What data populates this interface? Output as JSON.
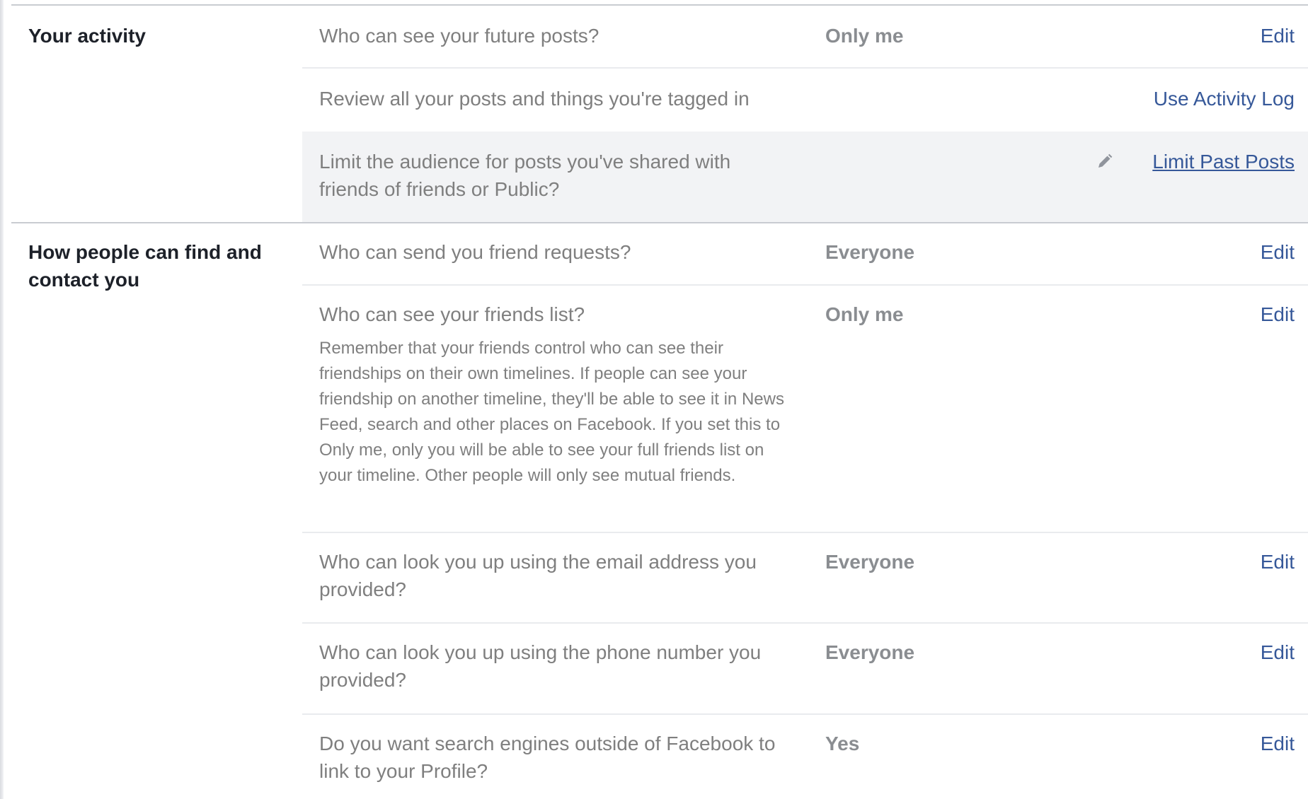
{
  "sections": [
    {
      "title": "Your activity",
      "rows": [
        {
          "question": "Who can see your future posts?",
          "value": "Only me",
          "action": "Edit"
        },
        {
          "question": "Review all your posts and things you're tagged in",
          "action": "Use Activity Log"
        },
        {
          "question": "Limit the audience for posts you've shared with friends of friends or Public?",
          "action": "Limit Past Posts",
          "icon": "pencil-icon"
        }
      ]
    },
    {
      "title": "How people can find and contact you",
      "rows": [
        {
          "question": "Who can send you friend requests?",
          "value": "Everyone",
          "action": "Edit"
        },
        {
          "question": "Who can see your friends list?",
          "value": "Only me",
          "action": "Edit",
          "help": "Remember that your friends control who can see their friendships on their own timelines. If people can see your friendship on another timeline, they'll be able to see it in News Feed, search and other places on Facebook. If you set this to Only me, only you will be able to see your full friends list on your timeline. Other people will only see mutual friends."
        },
        {
          "question": "Who can look you up using the email address you provided?",
          "value": "Everyone",
          "action": "Edit"
        },
        {
          "question": "Who can look you up using the phone number you provided?",
          "value": "Everyone",
          "action": "Edit"
        },
        {
          "question": "Do you want search engines outside of Facebook to link to your Profile?",
          "value": "Yes",
          "action": "Edit"
        }
      ]
    }
  ],
  "colors": {
    "link": "#365899",
    "question_text": "#7f7f7f",
    "value_text": "#8a8d91",
    "heading_text": "#1d2129",
    "shaded_row": "#f2f3f5",
    "divider": "#e9ebee",
    "section_rule": "#c9ccd1"
  }
}
